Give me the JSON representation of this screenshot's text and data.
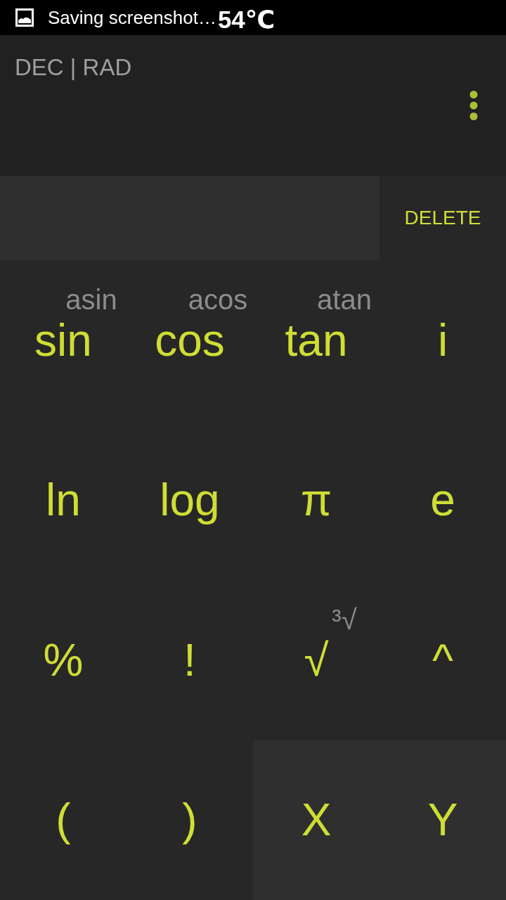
{
  "status_bar": {
    "notification": "Saving screenshot…",
    "temperature": "54℃"
  },
  "header": {
    "mode": "DEC | RAD"
  },
  "display": {
    "delete_label": "DELETE"
  },
  "keypad": {
    "rows": [
      [
        {
          "label": "sin",
          "secondary": "asin",
          "kind": "function"
        },
        {
          "label": "cos",
          "secondary": "acos",
          "kind": "function"
        },
        {
          "label": "tan",
          "secondary": "atan",
          "kind": "function"
        },
        {
          "label": "i",
          "kind": "function"
        }
      ],
      [
        {
          "label": "ln",
          "kind": "function"
        },
        {
          "label": "log",
          "kind": "function"
        },
        {
          "label": "π",
          "kind": "function"
        },
        {
          "label": "e",
          "kind": "function"
        }
      ],
      [
        {
          "label": "%",
          "kind": "function"
        },
        {
          "label": "!",
          "kind": "function"
        },
        {
          "label": "√",
          "secondary": "³√",
          "kind": "function"
        },
        {
          "label": "^",
          "kind": "function"
        }
      ],
      [
        {
          "label": "(",
          "kind": "function"
        },
        {
          "label": ")",
          "kind": "function"
        },
        {
          "label": "X",
          "kind": "variable"
        },
        {
          "label": "Y",
          "kind": "variable"
        }
      ]
    ]
  }
}
